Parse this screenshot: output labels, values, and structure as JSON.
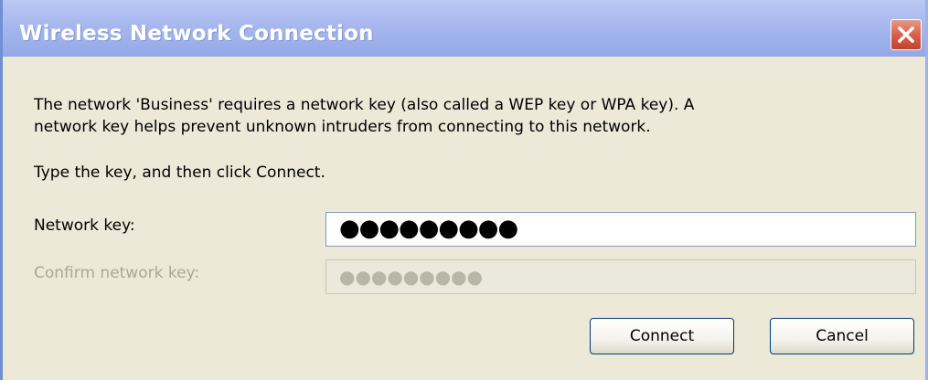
{
  "window": {
    "title": "Wireless Network Connection"
  },
  "message": {
    "line1": "The network 'Business' requires a network key (also called a WEP key or WPA key). A",
    "line2": "network key helps prevent unknown intruders from connecting to this network.",
    "instruction": "Type the key, and then click Connect."
  },
  "form": {
    "network_key_label": "Network key:",
    "network_key_value": "●●●●●●●●●",
    "confirm_key_label": "Confirm network key:",
    "confirm_key_value": "●●●●●●●●●"
  },
  "buttons": {
    "connect": "Connect",
    "cancel": "Cancel"
  },
  "colors": {
    "titlebar": "#a7b8ee",
    "dialog_bg": "#ece9d8",
    "close_button": "#d9604a"
  },
  "icons": {
    "close": "close-icon"
  }
}
